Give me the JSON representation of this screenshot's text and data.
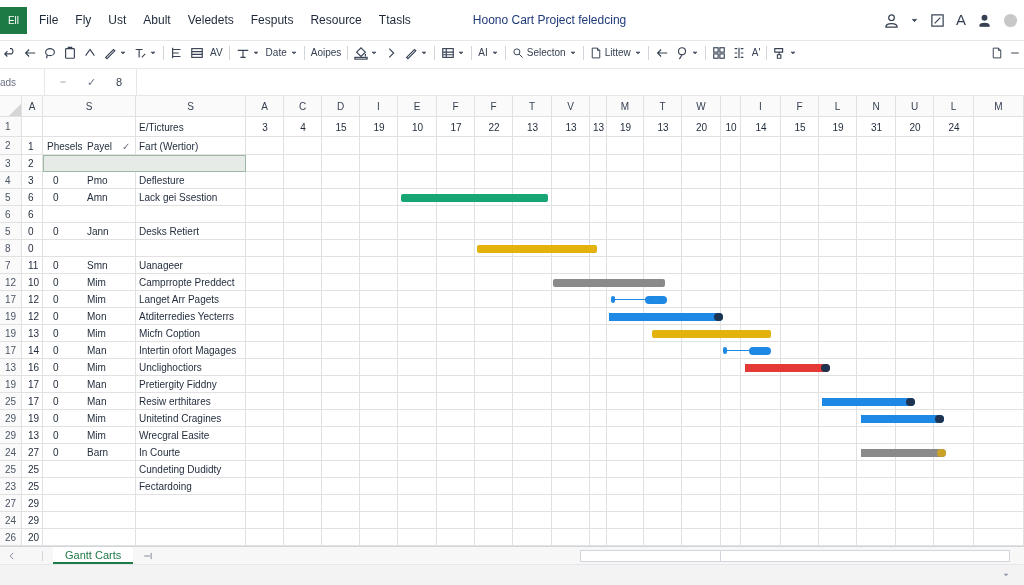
{
  "app_badge": "Ell",
  "menu": [
    "File",
    "Fly",
    "Ust",
    "Abult",
    "Veledets",
    "Fesputs",
    "Resource",
    "Ttasls"
  ],
  "window": {
    "title": "Hoono Cart Project feledcing"
  },
  "title_actions": [
    {
      "kind": "icon"
    },
    {
      "kind": "icon"
    },
    {
      "kind": "icon"
    },
    {
      "kind": "text",
      "label": "A"
    },
    {
      "kind": "icon"
    },
    {
      "kind": "icon"
    }
  ],
  "toolbar": [
    {
      "kind": "icon",
      "caret": false
    },
    {
      "kind": "icon",
      "caret": false
    },
    {
      "kind": "icon",
      "caret": false
    },
    {
      "kind": "icon",
      "caret": false
    },
    {
      "kind": "icon",
      "caret": false
    },
    {
      "kind": "icon",
      "caret": true
    },
    {
      "kind": "icon",
      "caret": true
    },
    {
      "kind": "sep"
    },
    {
      "kind": "icon",
      "caret": false
    },
    {
      "kind": "icon",
      "caret": false
    },
    {
      "kind": "text",
      "label": "AV",
      "caret": false
    },
    {
      "kind": "sep"
    },
    {
      "kind": "icon",
      "caret": true
    },
    {
      "kind": "text",
      "label": "Date",
      "caret": true
    },
    {
      "kind": "sep"
    },
    {
      "kind": "text",
      "label": "Aoipes",
      "caret": false
    },
    {
      "kind": "sep"
    },
    {
      "kind": "icon",
      "caret": true
    },
    {
      "kind": "icon",
      "caret": false
    },
    {
      "kind": "icon",
      "caret": true
    },
    {
      "kind": "sep"
    },
    {
      "kind": "icon",
      "caret": true
    },
    {
      "kind": "sep"
    },
    {
      "kind": "text",
      "label": "AI",
      "caret": true
    },
    {
      "kind": "sep"
    },
    {
      "kind": "icon-text",
      "label": "Selecton",
      "caret": true
    },
    {
      "kind": "sep"
    },
    {
      "kind": "icon-text",
      "label": "Littew",
      "caret": true
    },
    {
      "kind": "sep"
    },
    {
      "kind": "icon",
      "caret": false
    },
    {
      "kind": "icon",
      "caret": true
    },
    {
      "kind": "sep"
    },
    {
      "kind": "icon",
      "caret": false
    },
    {
      "kind": "icon",
      "caret": false
    },
    {
      "kind": "text",
      "label": "A'",
      "caret": false
    },
    {
      "kind": "sep"
    },
    {
      "kind": "icon",
      "caret": true
    }
  ],
  "toolbar_right": [
    {
      "kind": "icon"
    },
    {
      "kind": "icon"
    }
  ],
  "formula_bar": {
    "name_box": "ads",
    "confirm": "✓",
    "content": "8"
  },
  "left_columns": [
    "A",
    "S",
    "S"
  ],
  "gantt_columns": [
    {
      "header": "A",
      "value": "3"
    },
    {
      "header": "C",
      "value": "4"
    },
    {
      "header": "D",
      "value": "15"
    },
    {
      "header": "I",
      "value": "19"
    },
    {
      "header": "E",
      "value": "10"
    },
    {
      "header": "F",
      "value": "17"
    },
    {
      "header": "F",
      "value": "22"
    },
    {
      "header": "T",
      "value": "13"
    },
    {
      "header": "V",
      "value": "13"
    },
    {
      "value": "13"
    },
    {
      "header": "M",
      "value": "19"
    },
    {
      "header": "T",
      "value": "13"
    },
    {
      "header": "W",
      "value": "20"
    },
    {
      "value": "10"
    },
    {
      "header": "I",
      "value": "14"
    },
    {
      "header": "F",
      "value": "15"
    },
    {
      "header": "L",
      "value": "19"
    },
    {
      "header": "N",
      "value": "31"
    },
    {
      "header": "U",
      "value": "20"
    },
    {
      "header": "L",
      "value": "24"
    },
    {
      "header": "M"
    }
  ],
  "rows": [
    {
      "number": "1",
      "selected": false,
      "task": "E/Tictures"
    },
    {
      "number": "2",
      "a": "1",
      "b": "Phesels",
      "c": "Payel",
      "mark": "✓",
      "task": "Fart (Wertior)",
      "selected": false
    },
    {
      "number": "3",
      "a": "2",
      "selected": true
    },
    {
      "number": "4",
      "a": "3",
      "b": "0",
      "c": "Pmo",
      "task": "Deflesture",
      "selected": false
    },
    {
      "number": "5",
      "a": "6",
      "b": "0",
      "c": "Amn",
      "task": "Lack gei Ssestion",
      "selected": false,
      "bar": {
        "kind": "bar",
        "color": "#17a673"
      }
    },
    {
      "number": "6",
      "a": "6",
      "selected": false
    },
    {
      "number": "5",
      "a": "0",
      "b": "0",
      "c": "Jann",
      "task": "Desks Retiert",
      "selected": false
    },
    {
      "number": "8",
      "a": "0",
      "selected": false,
      "bar": {
        "kind": "bar",
        "color": "#e3b20c"
      }
    },
    {
      "number": "7",
      "a": "11",
      "b": "0",
      "c": "Smn",
      "task": "Uanageer",
      "selected": false
    },
    {
      "number": "12",
      "a": "10",
      "b": "0",
      "c": "Mim",
      "task": "Camprropte Preddect",
      "selected": false,
      "bar": {
        "kind": "bar",
        "color": "#8a8a8a"
      }
    },
    {
      "number": "17",
      "a": "12",
      "b": "0",
      "c": "Mim",
      "task": "Langet Arr Pagets",
      "selected": false,
      "bar": {
        "kind": "link",
        "color": "#1e88e5"
      }
    },
    {
      "number": "19",
      "a": "12",
      "b": "0",
      "c": "Mon",
      "task": "Atditerredies Yecterrs",
      "selected": false,
      "bar": {
        "kind": "bar",
        "color": "#1e88e5",
        "cap": {
          "color": "#1e3350"
        }
      }
    },
    {
      "number": "19",
      "a": "13",
      "b": "0",
      "c": "Mim",
      "task": "Micfn Coption",
      "selected": false,
      "bar": {
        "kind": "bar",
        "color": "#e3b20c"
      }
    },
    {
      "number": "17",
      "a": "14",
      "b": "0",
      "c": "Man",
      "task": "Intertin ofort Magages",
      "selected": false,
      "bar": {
        "kind": "link",
        "color": "#1e88e5"
      }
    },
    {
      "number": "13",
      "a": "16",
      "b": "0",
      "c": "Mim",
      "task": "Unclighoctiors",
      "selected": false,
      "bar": {
        "kind": "bar",
        "color": "#e53935",
        "cap": {
          "color": "#1e3350"
        }
      }
    },
    {
      "number": "19",
      "a": "17",
      "b": "0",
      "c": "Man",
      "task": "Pretiergity Fiddny",
      "selected": false
    },
    {
      "number": "25",
      "a": "17",
      "b": "0",
      "c": "Man",
      "task": "Resiw erthitares",
      "selected": false,
      "bar": {
        "kind": "bar",
        "color": "#1e88e5",
        "cap": {
          "color": "#1e3350"
        }
      }
    },
    {
      "number": "29",
      "a": "19",
      "b": "0",
      "c": "Mim",
      "task": "Unitetind Cragines",
      "selected": false,
      "bar": {
        "kind": "bar",
        "color": "#1e88e5",
        "cap": {
          "color": "#1e3350"
        }
      }
    },
    {
      "number": "29",
      "a": "13",
      "b": "0",
      "c": "Mim",
      "task": "Wrecgral Easite",
      "selected": false
    },
    {
      "number": "24",
      "a": "27",
      "b": "0",
      "c": "Barn",
      "task": "In Courte",
      "selected": false,
      "bar": {
        "kind": "bar",
        "color": "#8a8a8a",
        "cap": {
          "color": "#c9a227"
        }
      }
    },
    {
      "number": "25",
      "a": "25",
      "task": "Cundeting Dudidty",
      "selected": false
    },
    {
      "number": "23",
      "a": "25",
      "task": "Fectardoing",
      "selected": false
    },
    {
      "number": "27",
      "a": "29",
      "selected": false
    },
    {
      "number": "24",
      "a": "29",
      "selected": false
    },
    {
      "number": "26",
      "a": "20",
      "selected": false
    }
  ],
  "sheet_tabs": [
    {
      "label": "Gantt Carts",
      "selected": true
    }
  ]
}
